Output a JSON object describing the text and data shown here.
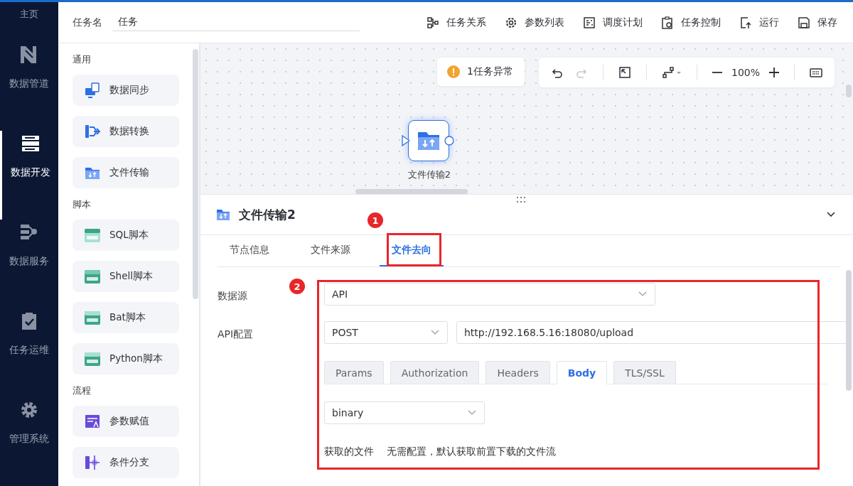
{
  "nav": {
    "home": "主页",
    "items": [
      {
        "label": "数据管道",
        "kind": "pipeline",
        "selected": false
      },
      {
        "label": "数据开发",
        "kind": "develop",
        "selected": true
      },
      {
        "label": "数据服务",
        "kind": "service",
        "selected": false
      },
      {
        "label": "任务运维",
        "kind": "ops",
        "selected": false
      },
      {
        "label": "管理系统",
        "kind": "settings",
        "selected": false
      }
    ]
  },
  "header": {
    "task_name_label": "任务名",
    "task_name_value": "任务",
    "actions": [
      {
        "label": "任务关系",
        "kind": "relation"
      },
      {
        "label": "参数列表",
        "kind": "params"
      },
      {
        "label": "调度计划",
        "kind": "schedule"
      },
      {
        "label": "任务控制",
        "kind": "control"
      },
      {
        "label": "运行",
        "kind": "run"
      },
      {
        "label": "保存",
        "kind": "save"
      }
    ]
  },
  "palette": {
    "groups": [
      {
        "title": "通用",
        "items": [
          {
            "label": "数据同步",
            "kind": "sync"
          },
          {
            "label": "数据转换",
            "kind": "transform"
          },
          {
            "label": "文件传输",
            "kind": "file"
          }
        ]
      },
      {
        "title": "脚本",
        "items": [
          {
            "label": "SQL脚本",
            "kind": "sql"
          },
          {
            "label": "Shell脚本",
            "kind": "shell"
          },
          {
            "label": "Bat脚本",
            "kind": "bat"
          },
          {
            "label": "Python脚本",
            "kind": "python"
          }
        ]
      },
      {
        "title": "流程",
        "items": [
          {
            "label": "参数赋值",
            "kind": "param"
          },
          {
            "label": "条件分支",
            "kind": "branch"
          }
        ]
      }
    ]
  },
  "canvas": {
    "warning": "1任务异常",
    "toolbar": [
      {
        "kind": "undo",
        "disabled": false
      },
      {
        "kind": "redo",
        "disabled": true
      },
      {
        "kind": "divider"
      },
      {
        "kind": "fit",
        "disabled": false
      },
      {
        "kind": "divider"
      },
      {
        "kind": "connector",
        "disabled": false
      },
      {
        "kind": "divider"
      },
      {
        "kind": "zoom-out",
        "disabled": false
      },
      {
        "kind": "zoom",
        "label": "100%"
      },
      {
        "kind": "zoom-in",
        "disabled": false
      },
      {
        "kind": "divider"
      },
      {
        "kind": "keyboard",
        "disabled": false
      }
    ],
    "node": {
      "label": "文件传输2",
      "selected": true
    }
  },
  "panel": {
    "title": "文件传输2",
    "tabs": [
      {
        "label": "节点信息",
        "selected": false
      },
      {
        "label": "文件来源",
        "selected": false
      },
      {
        "label": "文件去向",
        "selected": true
      }
    ],
    "data_source": {
      "label": "数据源",
      "value": "API"
    },
    "api_config": {
      "label": "API配置",
      "method": "POST",
      "url": "http://192.168.5.16:18080/upload",
      "tabs": [
        {
          "label": "Params",
          "selected": false
        },
        {
          "label": "Authorization",
          "selected": false
        },
        {
          "label": "Headers",
          "selected": false
        },
        {
          "label": "Body",
          "selected": true
        },
        {
          "label": "TLS/SSL",
          "selected": false
        }
      ],
      "body_type": "binary",
      "file_label": "获取的文件",
      "file_note": "无需配置，默认获取前置下载的文件流"
    },
    "annotations": [
      "1",
      "2"
    ]
  }
}
